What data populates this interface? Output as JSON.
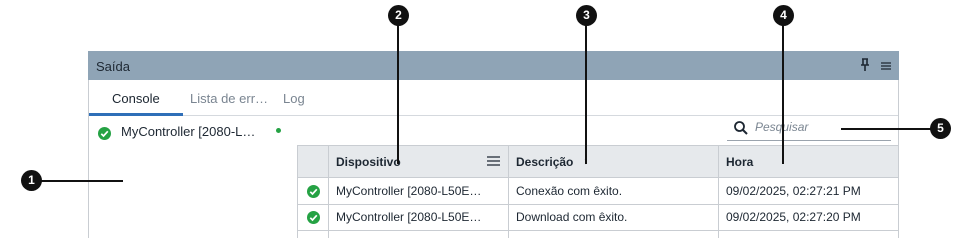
{
  "panel": {
    "title": "Saída",
    "header_icons": [
      "pin-icon",
      "menu-icon"
    ]
  },
  "tabs": [
    {
      "label": "Console",
      "active": true
    },
    {
      "label": "Lista de err…",
      "active": false
    },
    {
      "label": "Log",
      "active": false
    }
  ],
  "device_list": [
    {
      "name": "MyController [2080-L…",
      "status_icon": "check-icon",
      "online": true
    }
  ],
  "search": {
    "placeholder": "Pesquisar",
    "value": ""
  },
  "table": {
    "columns": [
      {
        "label": ""
      },
      {
        "label": "Dispositivo",
        "icon": "columns-menu-icon"
      },
      {
        "label": "Descrição",
        "icon": "sort-icon"
      },
      {
        "label": "Hora"
      }
    ],
    "rows": [
      {
        "status_icon": "check-icon",
        "device": "MyController [2080-L50E…",
        "description": "Conexão com êxito.",
        "time": "09/02/2025, 02:27:21 PM"
      },
      {
        "status_icon": "check-icon",
        "device": "MyController [2080-L50E…",
        "description": "Download com êxito.",
        "time": "09/02/2025, 02:27:20 PM"
      }
    ]
  },
  "callouts": [
    "1",
    "2",
    "3",
    "4",
    "5"
  ],
  "colors": {
    "header": "#8fa4b6",
    "accent": "#2f6fb8",
    "success": "#25a244",
    "callout": "#111111"
  }
}
